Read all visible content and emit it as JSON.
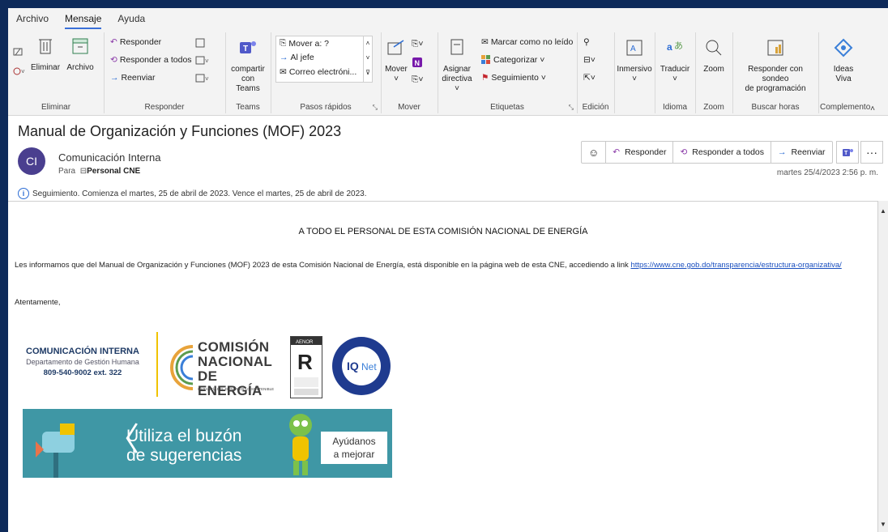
{
  "menu": {
    "tabs": [
      "Archivo",
      "Mensaje",
      "Ayuda"
    ],
    "active": "Mensaje"
  },
  "ribbon": {
    "eliminar": {
      "delete_label": "Eliminar",
      "archive_label": "Archivo",
      "group_label": "Eliminar"
    },
    "responder": {
      "reply": "Responder",
      "reply_all": "Responder a todos",
      "forward": "Reenviar",
      "group_label": "Responder"
    },
    "teams": {
      "share_label_1": "compartir",
      "share_label_2": "con Teams",
      "group_label": "Teams"
    },
    "pasos": {
      "items": [
        "Mover a: ?",
        "Al jefe",
        "Correo electróni..."
      ],
      "group_label": "Pasos rápidos"
    },
    "mover": {
      "move_label": "Mover",
      "group_label": "Mover"
    },
    "etiquetas": {
      "assign_1": "Asignar",
      "assign_2": "directiva",
      "mark_unread": "Marcar como no leído",
      "categorize": "Categorizar",
      "followup": "Seguimiento",
      "group_label": "Etiquetas"
    },
    "edicion": {
      "group_label": "Edición"
    },
    "inmersivo": {
      "label": "Inmersivo"
    },
    "idioma": {
      "translate": "Traducir",
      "group_label": "Idioma"
    },
    "zoom": {
      "label": "Zoom",
      "group_label": "Zoom"
    },
    "buscar": {
      "line1": "Responder con sondeo",
      "line2": "de programación",
      "group_label": "Buscar horas"
    },
    "complemento": {
      "line1": "Ideas",
      "line2": "Viva",
      "group_label": "Complemento"
    }
  },
  "message": {
    "subject": "Manual de Organización y Funciones (MOF) 2023",
    "avatar_initials": "CI",
    "sender": "Comunicación Interna",
    "to_prefix": "Para",
    "to_recipient": "Personal CNE",
    "date": "martes 25/4/2023 2:56 p. m.",
    "followup": "Seguimiento.  Comienza el martes, 25 de abril de 2023.  Vence el martes, 25 de abril de 2023.",
    "actions": {
      "reply": "Responder",
      "reply_all": "Responder a todos",
      "forward": "Reenviar"
    }
  },
  "body": {
    "headline": "A TODO EL PERSONAL DE ESTA COMISIÓN NACIONAL DE ENERGÍA",
    "paragraph": "Les informamos que del Manual de Organización y Funciones (MOF) 2023 de esta Comisión Nacional de Energía, está disponible en la página web de esta CNE, accediendo a link ",
    "link": "https://www.cne.gob.do/transparencia/estructura-organizativa/",
    "closing": "Atentamente,"
  },
  "signature": {
    "ci_title": "COMUNICACIÓN INTERNA",
    "ci_dept": "Departamento de Gestión Humana",
    "ci_phone": "809-540-9002 ext. 322",
    "cne_line1": "COMISIÓN",
    "cne_line2": "NACIONAL DE",
    "cne_line3": "ENERGÍA",
    "cne_tagline": "GARANTÍA DEL DESARROLLO SOSTENIBLE",
    "banner_line1": "Utiliza el buzón",
    "banner_line2": "de sugerencias",
    "banner_cta_1": "Ayúdanos",
    "banner_cta_2": "a mejorar"
  }
}
